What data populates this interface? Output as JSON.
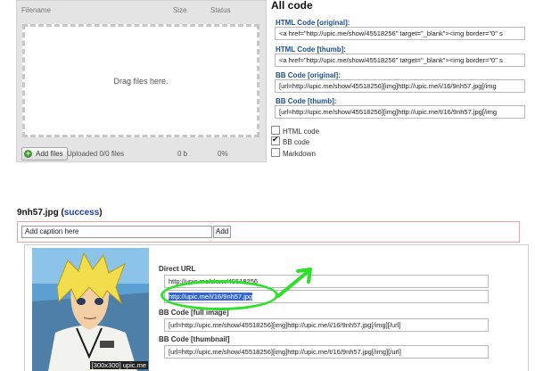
{
  "uploader": {
    "col_filename": "Filename",
    "col_size": "Size",
    "col_status": "Status",
    "drop_text": "Drag files here.",
    "add_button": "Add files",
    "uploaded": "Uploaded 0/0 files",
    "total_size": "0 b",
    "percent": "0%"
  },
  "all_code": {
    "title": "All code",
    "html_original_label": "HTML Code [original]:",
    "html_original_value": "<a href=\"http://upic.me/show/45518256\" target=\"_blank\"><img border=\"0\" s",
    "html_thumb_label": "HTML Code [thumb]:",
    "html_thumb_value": "<a href=\"http://upic.me/show/45518256\" target=\"_blank\"><img border=\"0\" s",
    "bb_original_label": "BB Code [original]:",
    "bb_original_value": "[url=http://upic.me/show/45518256][img]http://upic.me/i/16/9nh57.jpg[/img",
    "bb_thumb_label": "BB Code [thumb]:",
    "bb_thumb_value": "[url=http://upic.me/show/45518256][img]http://upic.me/t/16/9nh57.jpg[/img",
    "options": [
      {
        "label": "HTML code",
        "checked": false
      },
      {
        "label": "BB code",
        "checked": true
      },
      {
        "label": "Markdown",
        "checked": false
      }
    ]
  },
  "result": {
    "filename": "9nh57.jpg",
    "status": "success",
    "caption_placeholder": "Add caption here",
    "caption_add": "Add",
    "thumb_size": "[300x300] upic.me",
    "direct_url_label": "Direct URL",
    "direct_url_show": "http://upic.me/show/45518256",
    "direct_url_image": "http://upic.me/i/16/9nh57.jpg",
    "bb_full_label": "BB Code [full image]",
    "bb_full_value": "[url=http://upic.me/show/45518256][img]http://upic.me/i/16/9nh57.jpg[/img][/url]",
    "bb_thumb_label": "BB Code [thumbnail]",
    "bb_thumb_value": "[url=http://upic.me/show/45518256][img]http://upic.me/t/16/9nh57.jpg[/img][/url]"
  },
  "colors": {
    "annotation": "#2de028",
    "link_blue": "#1a3cb4",
    "label_blue": "#1b4f8c",
    "selection": "#3366cc"
  }
}
